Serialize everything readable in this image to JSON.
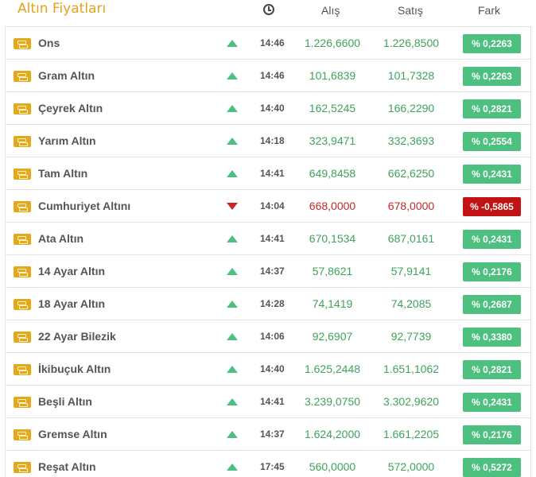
{
  "header": {
    "title": "Altın Fiyatları",
    "col_buy": "Alış",
    "col_sell": "Satış",
    "col_diff": "Fark"
  },
  "colors": {
    "up": "#4dbf7f",
    "down": "#c11313",
    "accent": "#e3a21a"
  },
  "rows": [
    {
      "name": "Ons",
      "dir": "up",
      "time": "14:46",
      "buy": "1.226,6600",
      "sell": "1.226,8500",
      "diff": "% 0,2263"
    },
    {
      "name": "Gram Altın",
      "dir": "up",
      "time": "14:46",
      "buy": "101,6839",
      "sell": "101,7328",
      "diff": "% 0,2263"
    },
    {
      "name": "Çeyrek Altın",
      "dir": "up",
      "time": "14:40",
      "buy": "162,5245",
      "sell": "166,2290",
      "diff": "% 0,2821"
    },
    {
      "name": "Yarım Altın",
      "dir": "up",
      "time": "14:18",
      "buy": "323,9471",
      "sell": "332,3693",
      "diff": "% 0,2554"
    },
    {
      "name": "Tam Altın",
      "dir": "up",
      "time": "14:41",
      "buy": "649,8458",
      "sell": "662,6250",
      "diff": "% 0,2431"
    },
    {
      "name": "Cumhuriyet Altını",
      "dir": "down",
      "time": "14:04",
      "buy": "668,0000",
      "sell": "678,0000",
      "diff": "% -0,5865"
    },
    {
      "name": "Ata Altın",
      "dir": "up",
      "time": "14:41",
      "buy": "670,1534",
      "sell": "687,0161",
      "diff": "% 0,2431"
    },
    {
      "name": "14 Ayar Altın",
      "dir": "up",
      "time": "14:37",
      "buy": "57,8621",
      "sell": "57,9141",
      "diff": "% 0,2176"
    },
    {
      "name": "18 Ayar Altın",
      "dir": "up",
      "time": "14:28",
      "buy": "74,1419",
      "sell": "74,2085",
      "diff": "% 0,2687"
    },
    {
      "name": "22 Ayar Bilezik",
      "dir": "up",
      "time": "14:06",
      "buy": "92,6907",
      "sell": "92,7739",
      "diff": "% 0,3380"
    },
    {
      "name": "İkibuçuk Altın",
      "dir": "up",
      "time": "14:40",
      "buy": "1.625,2448",
      "sell": "1.651,1062",
      "diff": "% 0,2821"
    },
    {
      "name": "Beşli Altın",
      "dir": "up",
      "time": "14:41",
      "buy": "3.239,0750",
      "sell": "3.302,9620",
      "diff": "% 0,2431"
    },
    {
      "name": "Gremse Altın",
      "dir": "up",
      "time": "14:37",
      "buy": "1.624,2000",
      "sell": "1.661,2205",
      "diff": "% 0,2176"
    },
    {
      "name": "Reşat Altın",
      "dir": "up",
      "time": "17:45",
      "buy": "560,0000",
      "sell": "572,0000",
      "diff": "% 0,5272"
    }
  ]
}
